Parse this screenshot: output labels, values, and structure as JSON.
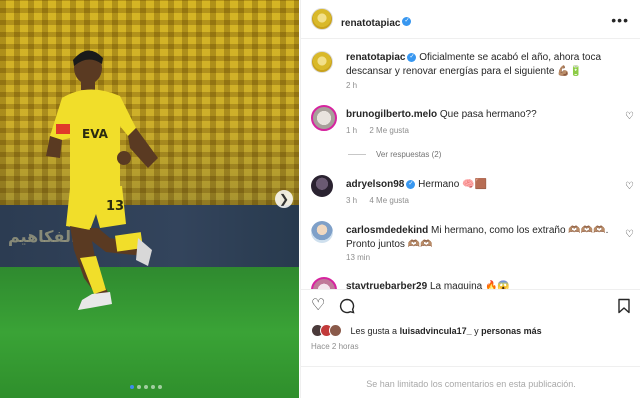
{
  "post": {
    "username": "renatotapiac",
    "carousel_dots": 5,
    "active_dot": 0,
    "jersey_number": "13",
    "adboard_text": "الفكاهيم"
  },
  "header": {
    "username": "renatotapiac",
    "more_icon": "more-horizontal-icon"
  },
  "caption": {
    "username": "renatotapiac",
    "text": "Oficialmente se acabó el año, ahora toca descansar y renovar energías para el siguiente 💪🏽🔋",
    "time": "2 h"
  },
  "comments": [
    {
      "username": "brunogilberto.melo",
      "text": "Que pasa hermano??",
      "time": "1 h",
      "likes": "2 Me gusta",
      "replies": "Ver respuestas (2)"
    },
    {
      "username": "adryelson98",
      "text": "Hermano 🧠🟫",
      "time": "3 h",
      "likes": "4 Me gusta"
    },
    {
      "username": "carlosmdedekind",
      "text": "Mi hermano, como los extraño 🫶🏽🫶🏽🫶🏽. Pronto juntos 🫶🏽🫶🏽",
      "time": "13 min"
    },
    {
      "username": "stavtruebarber29",
      "text": "La maquina 🔥😱"
    }
  ],
  "likes": {
    "prefix": "Les gusta a",
    "user": "luisadvincula17_",
    "conj": "y",
    "others": "personas más"
  },
  "post_time": "Hace 2 horas",
  "limited_text": "Se han limitado los comentarios en esta publicación."
}
